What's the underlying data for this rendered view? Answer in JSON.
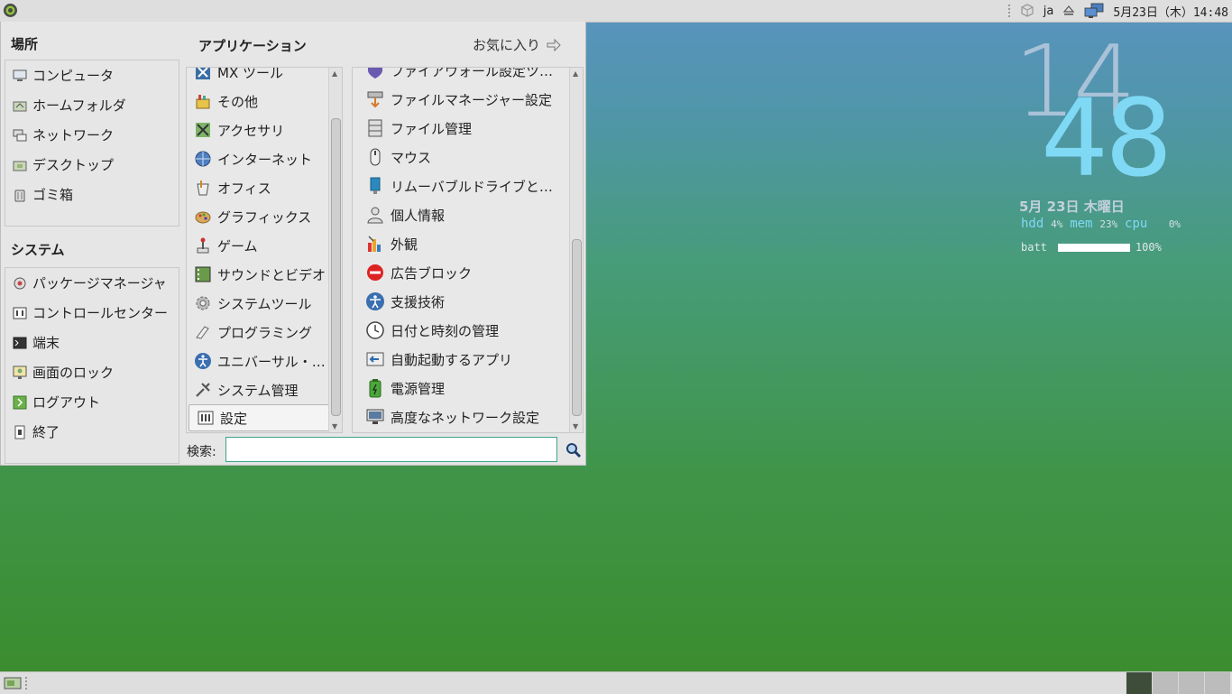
{
  "top_panel": {
    "keyboard_layout": "ja",
    "clock": "5月23日（木）14:48"
  },
  "menu": {
    "places_title": "場所",
    "places": [
      {
        "label": "コンピュータ",
        "icon": "computer-icon"
      },
      {
        "label": "ホームフォルダ",
        "icon": "home-folder-icon"
      },
      {
        "label": "ネットワーク",
        "icon": "network-icon"
      },
      {
        "label": "デスクトップ",
        "icon": "desktop-icon"
      },
      {
        "label": "ゴミ箱",
        "icon": "trash-icon"
      }
    ],
    "system_title": "システム",
    "system": [
      {
        "label": "パッケージマネージャ",
        "icon": "package-manager-icon"
      },
      {
        "label": "コントロールセンター",
        "icon": "control-center-icon"
      },
      {
        "label": "端末",
        "icon": "terminal-icon"
      },
      {
        "label": "画面のロック",
        "icon": "lock-screen-icon"
      },
      {
        "label": "ログアウト",
        "icon": "logout-icon"
      },
      {
        "label": "終了",
        "icon": "shutdown-icon"
      }
    ],
    "applications_title": "アプリケーション",
    "favorites_label": "お気に入り",
    "categories": [
      "MX ツール",
      "その他",
      "アクセサリ",
      "インターネット",
      "オフィス",
      "グラフィックス",
      "ゲーム",
      "サウンドとビデオ",
      "システムツール",
      "プログラミング",
      "ユニバーサル・…",
      "システム管理",
      "設定"
    ],
    "selected_category": "設定",
    "apps": [
      "ファイアウォール設定ツ…",
      "ファイルマネージャー設定",
      "ファイル管理",
      "マウス",
      "リムーバブルドライブと…",
      "個人情報",
      "外観",
      "広告ブロック",
      "支援技術",
      "日付と時刻の管理",
      "自動起動するアプリ",
      "電源管理",
      "高度なネットワーク設定"
    ],
    "search_label": "検索:",
    "search_value": ""
  },
  "conky": {
    "hour": "14",
    "minute": "48",
    "date": "5月 23日 木曜日",
    "hdd_label": "hdd",
    "hdd_value": "4%",
    "mem_label": "mem",
    "mem_value": "23%",
    "cpu_label": "cpu",
    "cpu_value": "0%",
    "batt_label": "batt",
    "batt_value": "100%",
    "batt_level": 1.0
  },
  "colors": {
    "accent": "#3aa58a",
    "conky_minute": "#7fd9f4",
    "conky_hour": "#a9c2d8"
  }
}
